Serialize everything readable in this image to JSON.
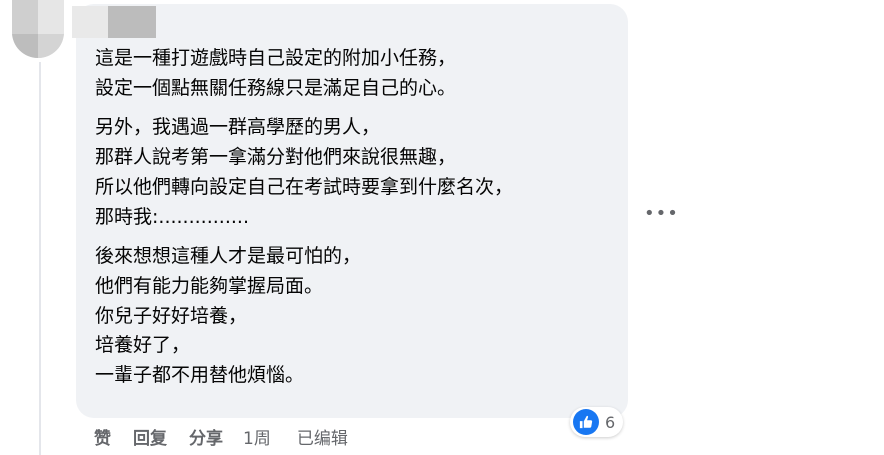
{
  "comment": {
    "paragraphs": [
      [
        "這是一種打遊戲時自己設定的附加小任務，",
        "設定一個點無關任務線只是滿足自己的心。"
      ],
      [
        "另外，我遇過一群高學歷的男人，",
        "那群人說考第一拿滿分對他們來說很無趣，",
        "所以他們轉向設定自己在考試時要拿到什麼名次，",
        "那時我:..............."
      ],
      [
        "後來想想這種人才是最可怕的，",
        "他們有能力能夠掌握局面。",
        "你兒子好好培養，",
        "培養好了，",
        "一輩子都不用替他煩惱。"
      ]
    ],
    "more_label": "•••"
  },
  "reactions": {
    "icon": "like-icon",
    "count": "6",
    "color": "#1877f2"
  },
  "actions": {
    "like": "赞",
    "reply": "回复",
    "share": "分享",
    "time": "1周",
    "edited": "已编辑"
  }
}
